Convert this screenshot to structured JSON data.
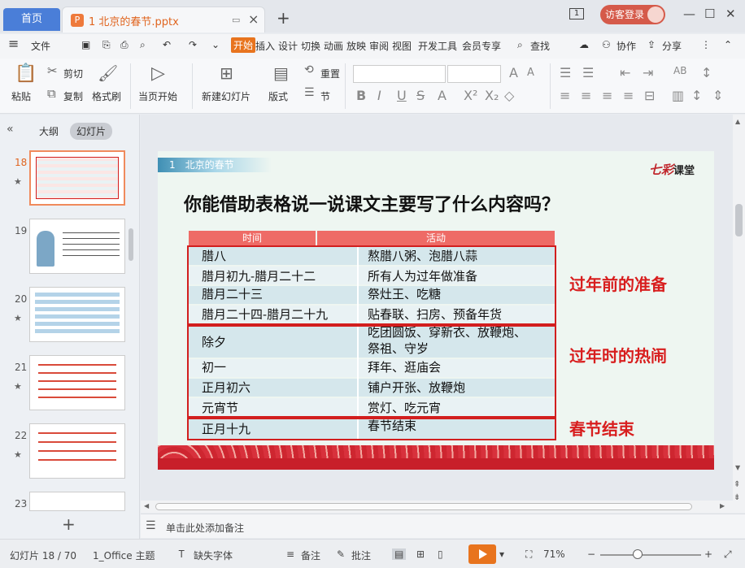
{
  "titlebar": {
    "home_tab": "首页",
    "doc_tab": "1 北京的春节.pptx",
    "login": "访客登录"
  },
  "menu": {
    "items": [
      "文件",
      "开始",
      "插入",
      "设计",
      "切换",
      "动画",
      "放映",
      "审阅",
      "视图",
      "开发工具",
      "会员专享",
      "查找",
      "协作",
      "分享"
    ],
    "active": "开始"
  },
  "ribbon": {
    "paste": "粘贴",
    "cut": "剪切",
    "copy": "复制",
    "format_painter": "格式刷",
    "from_current": "当页开始",
    "new_slide": "新建幻灯片",
    "layout": "版式",
    "reset": "重置",
    "section": "节"
  },
  "leftpanel": {
    "tab_outline": "大纲",
    "tab_slides": "幻灯片",
    "thumbnails": [
      "18",
      "19",
      "20",
      "21",
      "22",
      "23"
    ],
    "current": "18"
  },
  "slide": {
    "header": "1　北京的春节",
    "logo_main": "七彩",
    "logo_sub": "课堂",
    "title": "你能借助表格说一说课文主要写了什么内容吗？",
    "columns": [
      "时间",
      "活动"
    ],
    "rows": [
      {
        "time": "腊八",
        "activity": "熬腊八粥、泡腊八蒜"
      },
      {
        "time": "腊月初九-腊月二十二",
        "activity": "所有人为过年做准备"
      },
      {
        "time": "腊月二十三",
        "activity": "祭灶王、吃糖"
      },
      {
        "time": "腊月二十四-腊月二十九",
        "activity": "贴春联、扫房、预备年货"
      },
      {
        "time": "除夕",
        "activity": "吃团圆饭、穿新衣、放鞭炮、"
      },
      {
        "time": "",
        "activity": "祭祖、守岁"
      },
      {
        "time": "初一",
        "activity": "拜年、逛庙会"
      },
      {
        "time": "正月初六",
        "activity": "铺户开张、放鞭炮"
      },
      {
        "time": "元宵节",
        "activity": "赏灯、吃元宵"
      },
      {
        "time": "正月十九",
        "activity": "春节结束"
      }
    ],
    "notes": [
      "过年前的准备",
      "过年时的热闹",
      "春节结束"
    ]
  },
  "notebar": {
    "placeholder": "单击此处添加备注"
  },
  "status": {
    "slide_info": "幻灯片 18 / 70",
    "theme": "1_Office 主题",
    "missing_font": "缺失字体",
    "notes": "备注",
    "comments": "批注",
    "zoom": "71%"
  }
}
